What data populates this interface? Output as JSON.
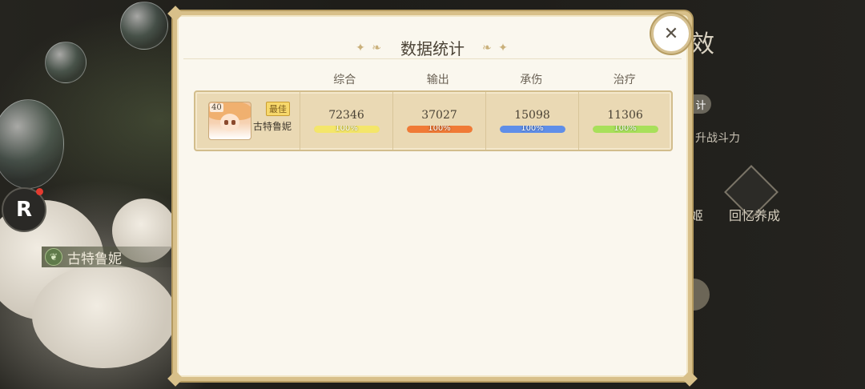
{
  "background": {
    "character_name": "古特鲁妮",
    "right_title": "效",
    "right_badge": "计",
    "right_text": "升战斗力",
    "right_label_a": "姬",
    "right_label_b": "回忆养成",
    "r_button_label": "R"
  },
  "modal": {
    "title": "数据统计",
    "title_ornament": "✦ ❧",
    "title_ornament_right": "❧ ✦",
    "close_icon": "✕",
    "columns": [
      "综合",
      "输出",
      "承伤",
      "治疗"
    ],
    "player": {
      "level": "40",
      "badge": "最佳",
      "name": "古特鲁妮",
      "stats": [
        {
          "value": "72346",
          "percent_label": "100%",
          "percent": 100,
          "color": "#f4e66a"
        },
        {
          "value": "37027",
          "percent_label": "100%",
          "percent": 100,
          "color": "#f07a36"
        },
        {
          "value": "15098",
          "percent_label": "100%",
          "percent": 100,
          "color": "#5f8ee8"
        },
        {
          "value": "11306",
          "percent_label": "100%",
          "percent": 100,
          "color": "#a8e05a"
        }
      ]
    }
  }
}
